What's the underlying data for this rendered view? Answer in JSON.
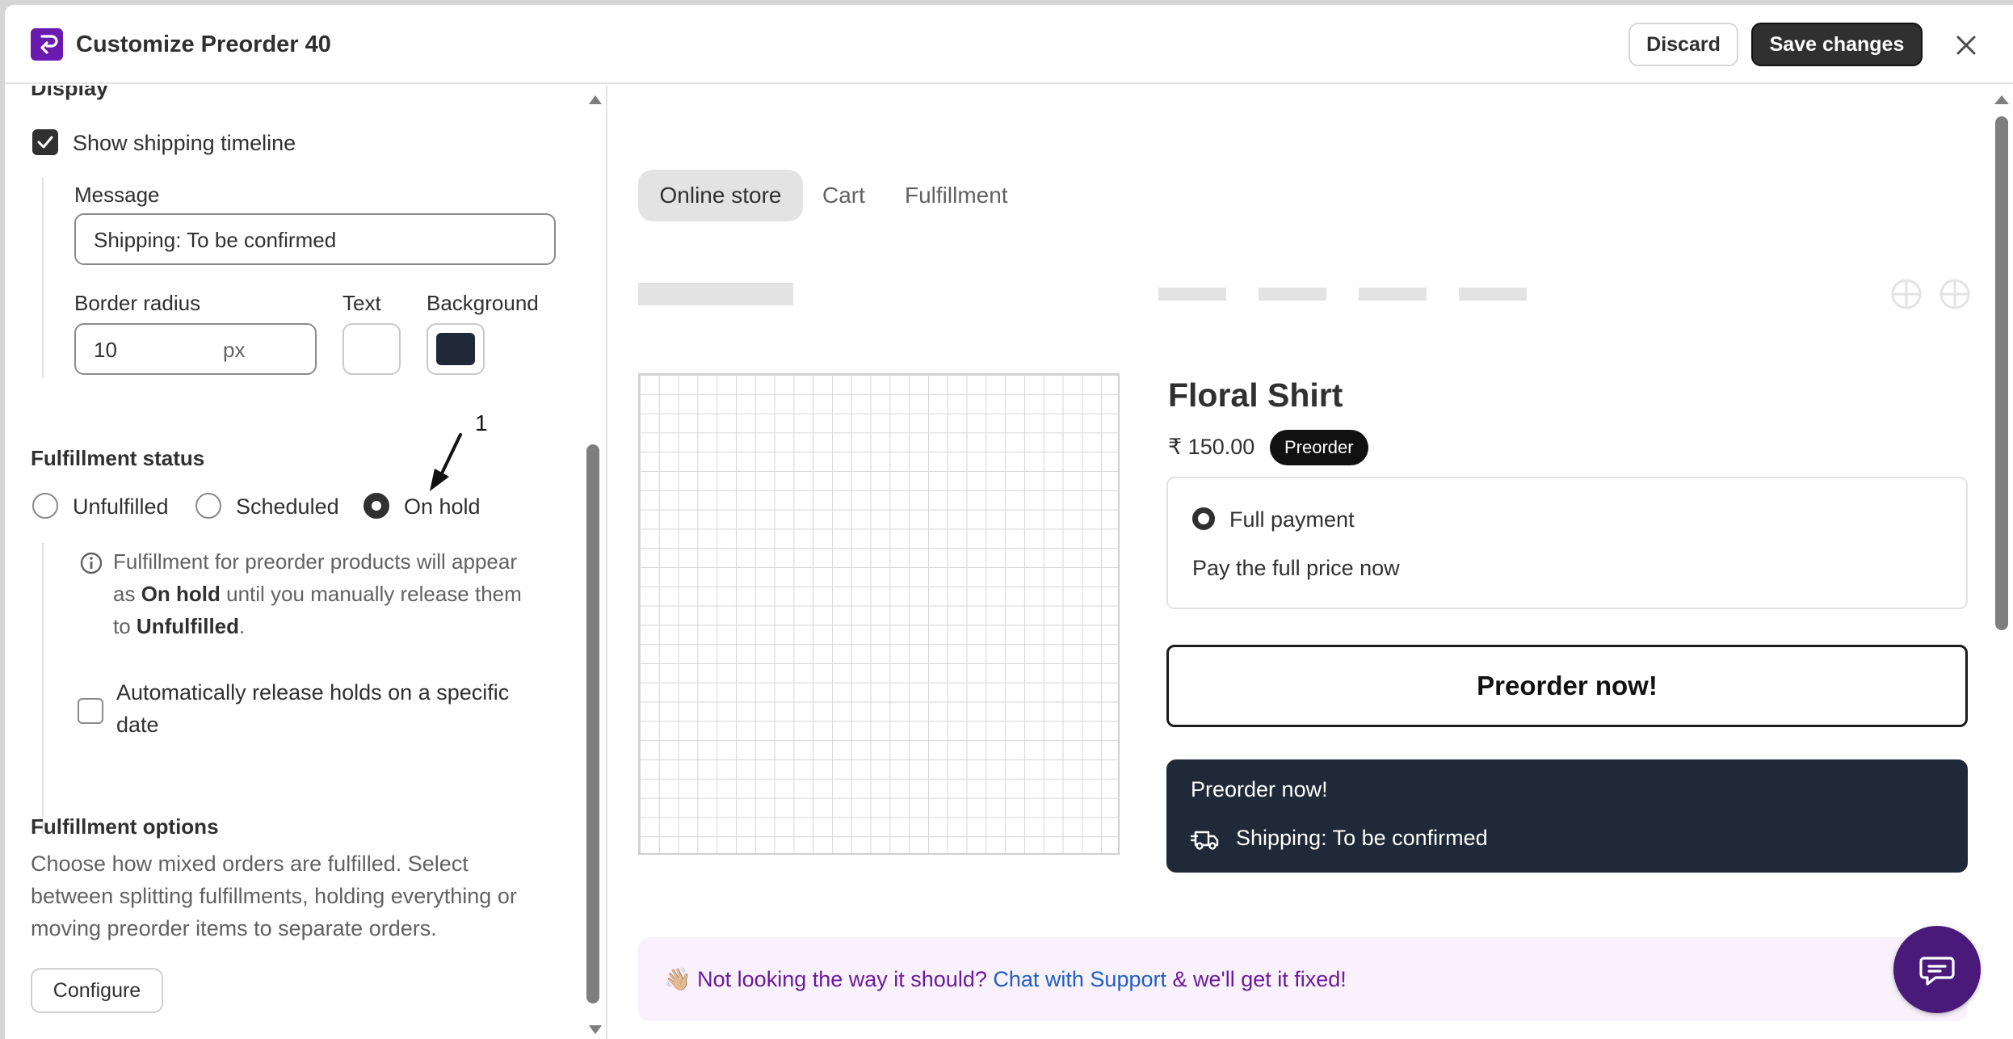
{
  "header": {
    "title": "Customize Preorder 40",
    "discard_label": "Discard",
    "save_label": "Save changes"
  },
  "left": {
    "section_display": "Display",
    "show_shipping_timeline": {
      "label": "Show shipping timeline",
      "checked": true
    },
    "message": {
      "label": "Message",
      "value": "Shipping: To be confirmed"
    },
    "border_radius": {
      "label": "Border radius",
      "value": "10",
      "unit": "px"
    },
    "text_color": {
      "label": "Text",
      "color": "#ffffff"
    },
    "background_color": {
      "label": "Background",
      "color": "#1f2937"
    },
    "annotation": "1",
    "fulfillment_status": {
      "title": "Fulfillment status",
      "options": [
        "Unfulfilled",
        "Scheduled",
        "On hold"
      ],
      "selected": "On hold",
      "info_part1": "Fulfillment for preorder products will appear",
      "info_part2": "as",
      "info_bold1": "On hold",
      "info_part3": "until you manually release them",
      "info_part4": "to",
      "info_bold2": "Unfulfilled",
      "info_part5": ".",
      "auto_release_line1": "Automatically release holds on a specific",
      "auto_release_line2": "date",
      "auto_release_checked": false
    },
    "fulfillment_options": {
      "title": "Fulfillment options",
      "desc_line1": "Choose how mixed orders are fulfilled. Select",
      "desc_line2": "between splitting fulfillments, holding everything or",
      "desc_line3": "moving preorder items to separate orders.",
      "configure_label": "Configure"
    }
  },
  "preview": {
    "tabs": [
      "Online store",
      "Cart",
      "Fulfillment"
    ],
    "active_tab": "Online store",
    "product": {
      "name": "Floral Shirt",
      "price": "₹ 150.00",
      "badge": "Preorder",
      "payment_option": "Full payment",
      "payment_desc": "Pay the full price now",
      "button_label": "Preorder now!",
      "card_title": "Preorder now!",
      "card_shipping": "Shipping: To be confirmed"
    },
    "banner": {
      "emoji": "👋🏼",
      "text1": "Not looking the way it should?",
      "link": "Chat with Support",
      "text2": "& we'll get it fixed!"
    }
  },
  "colors": {
    "brand": "#6b1ab0",
    "dark_button": "#303030",
    "card_bg": "#1f2937",
    "banner_text": "#6b1a9a",
    "link": "#1f5fbf"
  }
}
